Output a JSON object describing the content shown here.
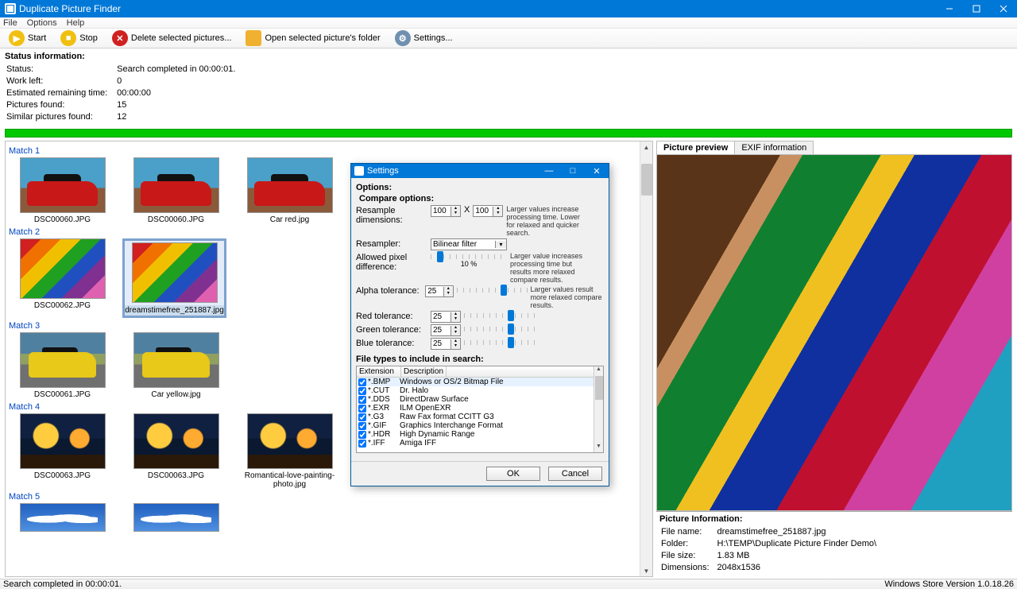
{
  "window": {
    "title": "Duplicate Picture Finder"
  },
  "menu": {
    "file": "File",
    "options": "Options",
    "help": "Help"
  },
  "toolbar": {
    "start": "Start",
    "stop": "Stop",
    "delete": "Delete selected pictures...",
    "open_folder": "Open selected picture's folder",
    "settings": "Settings..."
  },
  "status_info": {
    "header": "Status information:",
    "rows": {
      "status_l": "Status:",
      "status_v": "Search completed in 00:00:01.",
      "work_l": "Work left:",
      "work_v": "0",
      "eta_l": "Estimated remaining time:",
      "eta_v": "00:00:00",
      "found_l": "Pictures found:",
      "found_v": "15",
      "sim_l": "Similar pictures found:",
      "sim_v": "12"
    }
  },
  "matches": {
    "m1": {
      "hdr": "Match 1",
      "a": "DSC00060.JPG",
      "b": "DSC00060.JPG",
      "c": "Car red.jpg"
    },
    "m2": {
      "hdr": "Match 2",
      "a": "DSC00062.JPG",
      "b": "dreamstimefree_251887.jpg"
    },
    "m3": {
      "hdr": "Match 3",
      "a": "DSC00061.JPG",
      "b": "Car yellow.jpg"
    },
    "m4": {
      "hdr": "Match 4",
      "a": "DSC00063.JPG",
      "b": "DSC00063.JPG",
      "c": "Romantical-love-painting-photo.jpg"
    },
    "m5": {
      "hdr": "Match 5"
    }
  },
  "preview": {
    "tab1": "Picture preview",
    "tab2": "EXIF information"
  },
  "pic_info": {
    "header": "Picture Information:",
    "name_l": "File name:",
    "name_v": "dreamstimefree_251887.jpg",
    "folder_l": "Folder:",
    "folder_v": "H:\\TEMP\\Duplicate Picture Finder Demo\\",
    "size_l": "File size:",
    "size_v": "1.83 MB",
    "dim_l": "Dimensions:",
    "dim_v": "2048x1536"
  },
  "statusbar": {
    "left": "Search completed in 00:00:01.",
    "right": "Windows Store Version 1.0.18.26"
  },
  "settings": {
    "title": "Settings",
    "options": "Options:",
    "compare": "Compare options:",
    "resample_l": "Resample dimensions:",
    "resample_w": "100",
    "resample_x": "X",
    "resample_h": "100",
    "resample_hint": "Larger values increase processing time. Lower for relaxed and quicker search.",
    "resampler_l": "Resampler:",
    "resampler_v": "Bilinear filter",
    "pixel_l": "Allowed pixel difference:",
    "pixel_pct": "10 %",
    "pixel_hint": "Larger value increases processing time but results more relaxed compare results.",
    "alpha_l": "Alpha tolerance:",
    "alpha_v": "25",
    "alpha_hint": "Larger values result more relaxed compare results.",
    "red_l": "Red tolerance:",
    "red_v": "25",
    "green_l": "Green tolerance:",
    "green_v": "25",
    "blue_l": "Blue tolerance:",
    "blue_v": "25",
    "filetypes": "File types to include in search:",
    "col_ext": "Extension",
    "col_desc": "Description",
    "ft": [
      {
        "ext": "*.BMP",
        "desc": "Windows or OS/2 Bitmap File"
      },
      {
        "ext": "*.CUT",
        "desc": "Dr. Halo"
      },
      {
        "ext": "*.DDS",
        "desc": "DirectDraw Surface"
      },
      {
        "ext": "*.EXR",
        "desc": "ILM OpenEXR"
      },
      {
        "ext": "*.G3",
        "desc": "Raw Fax format CCITT G3"
      },
      {
        "ext": "*.GIF",
        "desc": "Graphics Interchange Format"
      },
      {
        "ext": "*.HDR",
        "desc": "High Dynamic Range"
      },
      {
        "ext": "*.IFF",
        "desc": "Amiga IFF"
      }
    ],
    "ok": "OK",
    "cancel": "Cancel"
  }
}
